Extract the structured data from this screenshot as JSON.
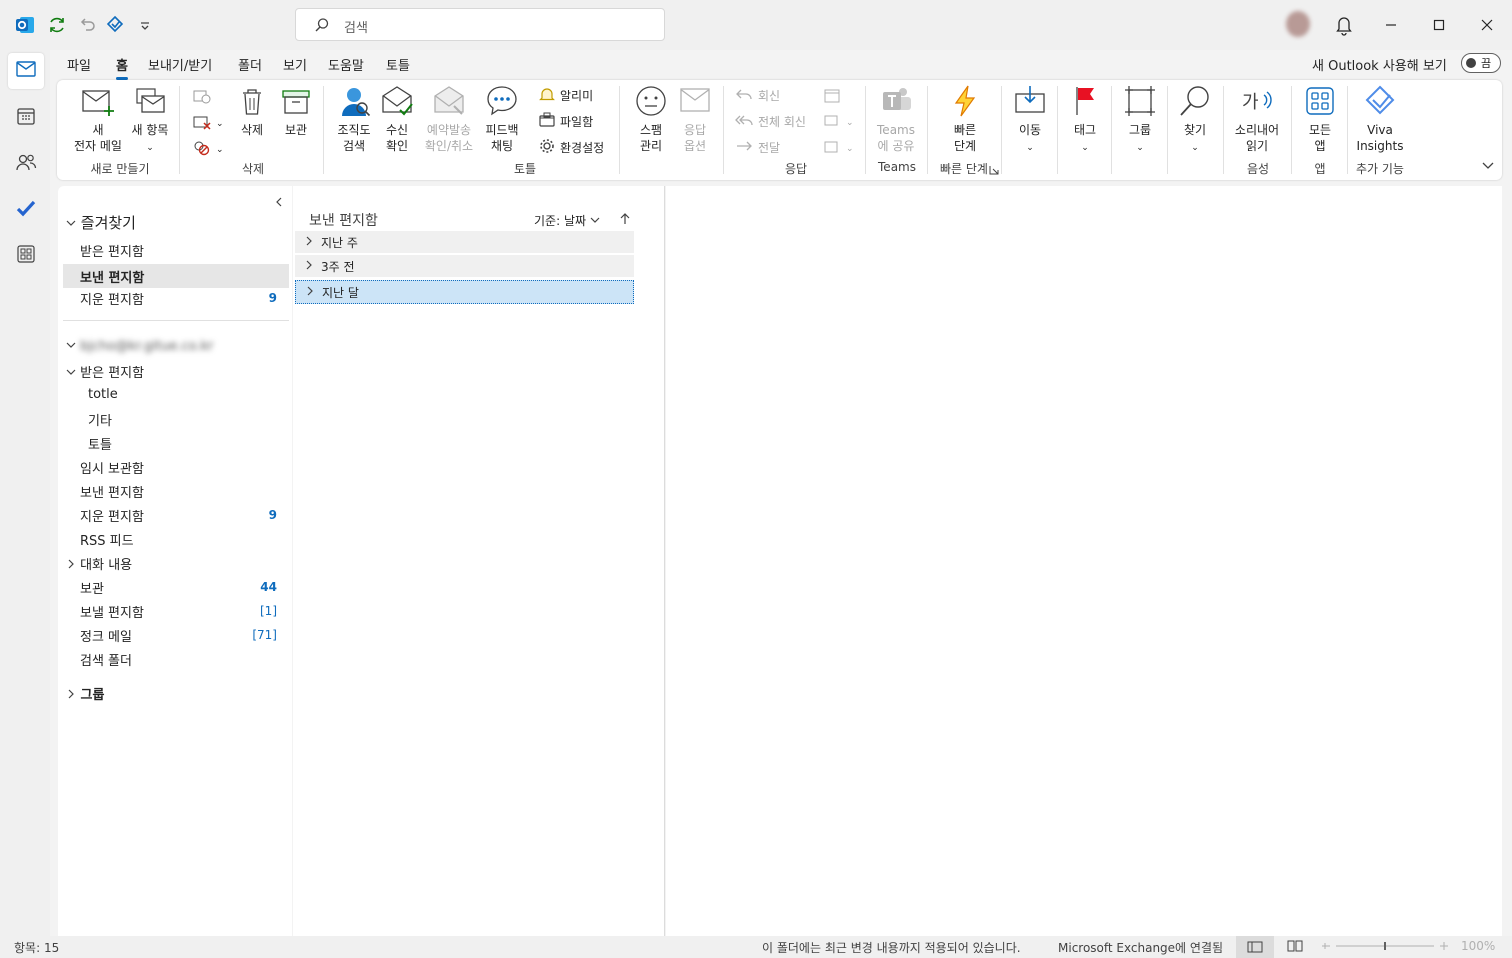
{
  "search": {
    "placeholder": "검색"
  },
  "menu": {
    "tabs": [
      "파일",
      "홈",
      "보내기/받기",
      "폴더",
      "보기",
      "도움말",
      "토틀"
    ],
    "selected": "홈",
    "new_outlook": "새 Outlook 사용해 보기",
    "toggle": "끔"
  },
  "ribbon": {
    "new_mail": "새\n전자 메일",
    "new_items": "새 항목",
    "grp_new": "새로 만들기",
    "delete": "삭제",
    "archive": "보관",
    "grp_delete": "삭제",
    "org_search": "조직도\n검색",
    "receipt": "수신\n확인",
    "schedule": "예약발송\n확인/취소",
    "feedback": "피드백\n채팅",
    "alarm": "알리미",
    "file_share": "파일함",
    "settings": "환경설정",
    "grp_totle": "토틀",
    "spam": "스팸\n관리",
    "reply_opts": "응답\n옵션",
    "reply": "회신",
    "reply_all": "전체 회신",
    "forward": "전달",
    "grp_reply": "응답",
    "teams_share": "Teams\n에 공유",
    "grp_teams": "Teams",
    "quick_steps": "빠른\n단계",
    "grp_quick": "빠른 단계",
    "move": "이동",
    "tags": "태그",
    "groups": "그룹",
    "find": "찾기",
    "read_aloud": "소리내어\n읽기",
    "grp_voice": "음성",
    "all_apps": "모든\n앱",
    "grp_apps": "앱",
    "viva": "Viva\nInsights",
    "grp_addins": "추가 기능"
  },
  "nav": {
    "favorites": "즐겨찾기",
    "fav_items": [
      {
        "label": "받은 편지함",
        "count": ""
      },
      {
        "label": "보낸 편지함",
        "count": ""
      },
      {
        "label": "지운 편지함",
        "count": "9"
      }
    ],
    "account": "bjcho@kr.gitue.co.kr",
    "inbox": "받은 편지함",
    "subfolders": [
      "totle",
      "기타",
      "토틀"
    ],
    "folders": [
      {
        "label": "임시 보관함",
        "count": ""
      },
      {
        "label": "보낸 편지함",
        "count": ""
      },
      {
        "label": "지운 편지함",
        "count": "9"
      },
      {
        "label": "RSS 피드",
        "count": ""
      },
      {
        "label": "대화 내용",
        "count": ""
      },
      {
        "label": "보관",
        "count": "44"
      },
      {
        "label": "보낼 편지함",
        "count": "[1]"
      },
      {
        "label": "정크 메일",
        "count": "[71]"
      },
      {
        "label": "검색 폴더",
        "count": ""
      }
    ],
    "groups": "그룹"
  },
  "list": {
    "title": "보낸 편지함",
    "sort": "기준: 날짜",
    "groups": [
      "지난 주",
      "3주 전",
      "지난 달"
    ]
  },
  "status": {
    "items": "항목: 15",
    "sync": "이 폴더에는 최근 변경 내용까지 적용되어 있습니다.",
    "connection": "Microsoft Exchange에 연결됨",
    "zoom": "100%"
  },
  "colors": {
    "accent": "#0f6cbd",
    "count": "#0f6cbd",
    "selection": "#cce4f7"
  }
}
